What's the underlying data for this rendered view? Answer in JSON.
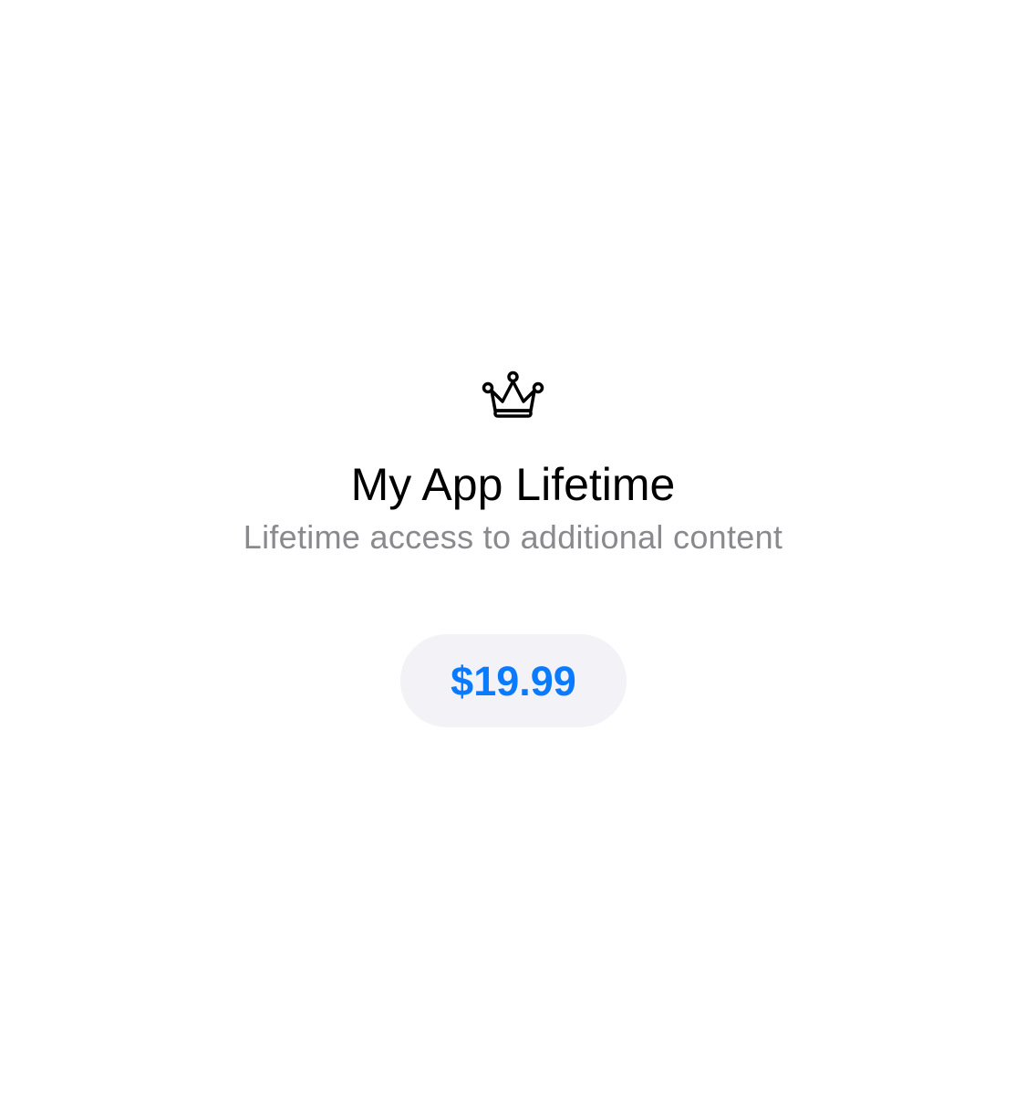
{
  "product": {
    "icon": "crown-icon",
    "title": "My App Lifetime",
    "subtitle": "Lifetime access to additional content",
    "price_label": "$19.99"
  },
  "colors": {
    "background": "#ffffff",
    "title": "#000000",
    "subtitle": "#8a8a8e",
    "price_text": "#0a7aff",
    "price_button_background": "#f2f2f7",
    "icon": "#000000"
  }
}
